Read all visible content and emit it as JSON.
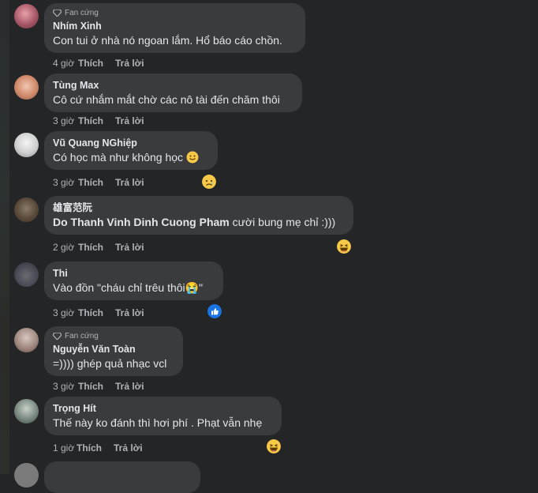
{
  "colors": {
    "background": "#242526",
    "bubble": "#3a3b3c",
    "text": "#e4e6eb",
    "muted": "#b0b3b8",
    "like_blue": "#1b74e4"
  },
  "comments": [
    {
      "badge": "Fan cứng",
      "name": "Nhím Xinh",
      "text": "Con tui ở nhà nó ngoan lắm. Hổ báo cáo chồn.",
      "time": "4 giờ",
      "like": "Thích",
      "reply": "Trả lời"
    },
    {
      "name": "Tùng Max",
      "text": "Cô cứ nhắm mắt chờ các nô tài đến chăm thôi",
      "time": "3 giờ",
      "like": "Thích",
      "reply": "Trả lời"
    },
    {
      "name": "Vũ Quang NGhiệp",
      "text": "Có học mà như không học",
      "inline_emoji": "smile-emoji-icon",
      "time": "3 giờ",
      "like": "Thích",
      "reply": "Trả lời",
      "reaction": "sad-reaction-icon"
    },
    {
      "name": "雄富范阮",
      "mention": "Do Thanh Vinh Dinh Cuong Pham",
      "text": " cười bung mẹ chỉ :)))",
      "time": "2 giờ",
      "like": "Thích",
      "reply": "Trả lời",
      "reaction": "haha-reaction-icon"
    },
    {
      "name": "Thi",
      "text": "Vào đồn \"cháu chỉ trêu thôi😭\"",
      "time": "3 giờ",
      "like": "Thích",
      "reply": "Trả lời",
      "reaction": "like-reaction-icon"
    },
    {
      "badge": "Fan cứng",
      "name": "Nguyễn Văn Toàn",
      "text": "=)))) ghép quả nhạc vcl",
      "time": "3 giờ",
      "like": "Thích",
      "reply": "Trả lời"
    },
    {
      "name": "Trọng Hít",
      "text": "Thế này ko đánh thì hơi phí . Phạt vẫn nhẹ",
      "time": "1 giờ",
      "like": "Thích",
      "reply": "Trả lời",
      "reaction": "haha-reaction-icon"
    }
  ]
}
